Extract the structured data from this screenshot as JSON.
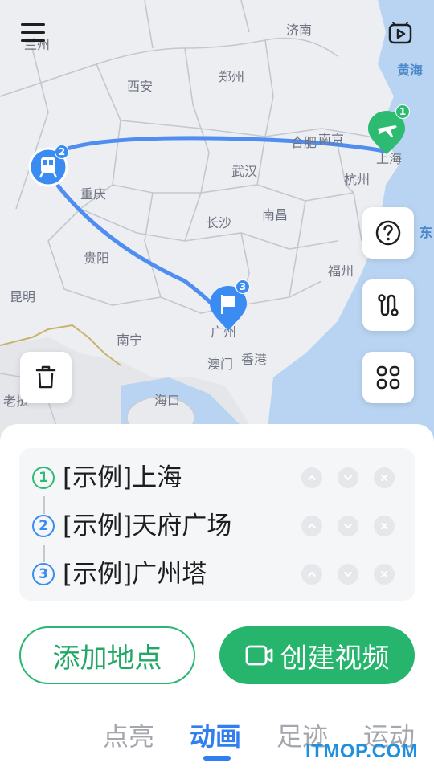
{
  "map": {
    "cities": [
      {
        "name": "兰州",
        "cls": ""
      },
      {
        "name": "济南",
        "cls": ""
      },
      {
        "name": "黄海",
        "cls": "sea"
      },
      {
        "name": "西安",
        "cls": ""
      },
      {
        "name": "郑州",
        "cls": ""
      },
      {
        "name": "合肥",
        "cls": ""
      },
      {
        "name": "南京",
        "cls": ""
      },
      {
        "name": "上海",
        "cls": ""
      },
      {
        "name": "杭州",
        "cls": ""
      },
      {
        "name": "武汉",
        "cls": ""
      },
      {
        "name": "重庆",
        "cls": ""
      },
      {
        "name": "长沙",
        "cls": ""
      },
      {
        "name": "南昌",
        "cls": ""
      },
      {
        "name": "东",
        "cls": "sea"
      },
      {
        "name": "贵阳",
        "cls": ""
      },
      {
        "name": "福州",
        "cls": ""
      },
      {
        "name": "昆明",
        "cls": ""
      },
      {
        "name": "南宁",
        "cls": ""
      },
      {
        "name": "广州",
        "cls": ""
      },
      {
        "name": "澳门",
        "cls": ""
      },
      {
        "name": "香港",
        "cls": ""
      },
      {
        "name": "海口",
        "cls": ""
      },
      {
        "name": "老挝",
        "cls": ""
      }
    ],
    "markers": [
      {
        "type": "plane",
        "badge": "1",
        "color": "#2dbb72"
      },
      {
        "type": "train",
        "badge": "2",
        "color": "#3b8cf2"
      },
      {
        "type": "flag",
        "badge": "3",
        "color": "#3b8cf2"
      }
    ]
  },
  "stops": [
    {
      "num": "1",
      "name": "[示例]上海",
      "color": "#2dbb72"
    },
    {
      "num": "2",
      "name": "[示例]天府广场",
      "color": "#3b8cf2"
    },
    {
      "num": "3",
      "name": "[示例]广州塔",
      "color": "#3b8cf2"
    }
  ],
  "actions": {
    "add_place": "添加地点",
    "create_video": "创建视频"
  },
  "tabs": [
    {
      "label": "点亮",
      "active": false
    },
    {
      "label": "动画",
      "active": true
    },
    {
      "label": "足迹",
      "active": false
    },
    {
      "label": "运动",
      "active": false
    }
  ],
  "watermark": "ITMOP.COM",
  "colors": {
    "accent_green": "#27b46d",
    "accent_blue": "#2f7ff0",
    "route_blue": "#4f8ef0"
  }
}
